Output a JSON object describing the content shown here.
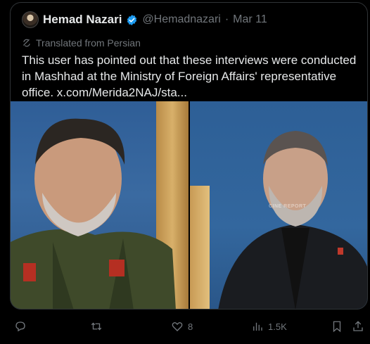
{
  "tweet": {
    "display_name": "Hemad Nazari",
    "handle": "@Hemadnazari",
    "separator": "·",
    "date": "Mar 11",
    "translated_label": "Translated from Persian",
    "text": "This user has pointed out that these interviews were conducted in Mashhad at the Ministry of Foreign Affairs' representative office. x.com/Merida2NAJ/sta...",
    "media_watermark": "CINE REPORT"
  },
  "actions": {
    "reply_count": "",
    "retweet_count": "",
    "like_count": "8",
    "views_count": "1.5K"
  },
  "icons": {
    "verified": "verified-badge-icon",
    "translate": "translate-icon",
    "reply": "reply-icon",
    "retweet": "retweet-icon",
    "like": "heart-icon",
    "views": "views-chart-icon",
    "bookmark": "bookmark-icon",
    "share": "share-icon"
  },
  "colors": {
    "background": "#000000",
    "text": "#e7e9ea",
    "muted": "#71767b",
    "verified": "#1d9bf0",
    "border": "#2f3336"
  }
}
